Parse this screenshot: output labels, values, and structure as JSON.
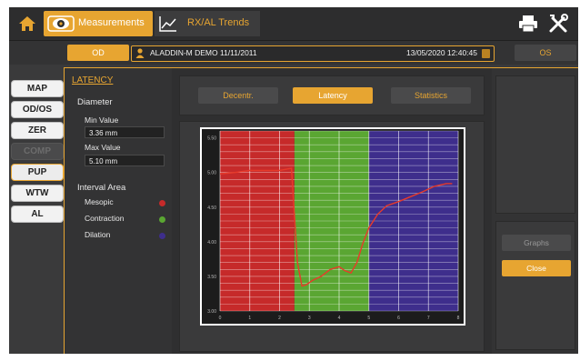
{
  "topbar": {
    "measurements_label": "Measurements",
    "trends_label": "RX/AL Trends",
    "home_icon": "home-icon",
    "print_icon": "printer-icon",
    "tools_icon": "tools-icon",
    "accent": "#e7a531"
  },
  "patient": {
    "od_label": "OD",
    "os_label": "OS",
    "name": "ALADDIN-M DEMO 11/11/2011",
    "datetime": "13/05/2020 12:40:45"
  },
  "nav": [
    {
      "label": "MAP",
      "state": "normal"
    },
    {
      "label": "OD/OS",
      "state": "normal"
    },
    {
      "label": "ZER",
      "state": "normal"
    },
    {
      "label": "COMP",
      "state": "disabled"
    },
    {
      "label": "PUP",
      "state": "active"
    },
    {
      "label": "WTW",
      "state": "normal"
    },
    {
      "label": "AL",
      "state": "normal"
    }
  ],
  "panel": {
    "title": "LATENCY",
    "diameter_label": "Diameter",
    "min_label": "Min Value",
    "min_value": "3.36 mm",
    "max_label": "Max Value",
    "max_value": "5.10 mm",
    "interval_label": "Interval Area",
    "legend": [
      {
        "label": "Mesopic",
        "color": "#c62a2a"
      },
      {
        "label": "Contraction",
        "color": "#5aa632"
      },
      {
        "label": "Dilation",
        "color": "#3e2e8c"
      }
    ]
  },
  "tabs": {
    "decentr": "Decentr.",
    "latency": "Latency",
    "statistics": "Statistics"
  },
  "actions": {
    "graphs": "Graphs",
    "close": "Close"
  },
  "chart_data": {
    "type": "line",
    "xlim": [
      0,
      8
    ],
    "ylim": [
      3.0,
      5.6
    ],
    "x_ticks": [
      "0",
      "1",
      "2",
      "3",
      "4",
      "5",
      "6",
      "7",
      "8"
    ],
    "y_ticks": [
      "3.00",
      "3.50",
      "4.00",
      "4.50",
      "5.00",
      "5.50"
    ],
    "bands": [
      {
        "name": "Mesopic",
        "from": 0,
        "to": 2.5,
        "color": "#c62a2a"
      },
      {
        "name": "Contraction",
        "from": 2.5,
        "to": 5,
        "color": "#5aa632"
      },
      {
        "name": "Dilation",
        "from": 5,
        "to": 8,
        "color": "#3e2e8c"
      }
    ],
    "series": [
      {
        "color": "#e83a2a",
        "x": [
          0,
          0.5,
          1,
          1.5,
          2,
          2.4,
          2.6,
          2.75,
          2.9,
          3.1,
          3.4,
          3.7,
          4.0,
          4.2,
          4.4,
          4.6,
          4.8,
          5.0,
          5.3,
          5.6,
          6.0,
          6.4,
          6.8,
          7.2,
          7.6,
          7.8
        ],
        "y": [
          4.98,
          5.0,
          5.03,
          5.03,
          5.03,
          5.06,
          3.7,
          3.36,
          3.38,
          3.44,
          3.5,
          3.6,
          3.64,
          3.58,
          3.55,
          3.7,
          3.98,
          4.2,
          4.4,
          4.52,
          4.58,
          4.65,
          4.72,
          4.8,
          4.84,
          4.84
        ]
      }
    ],
    "grid": true
  }
}
